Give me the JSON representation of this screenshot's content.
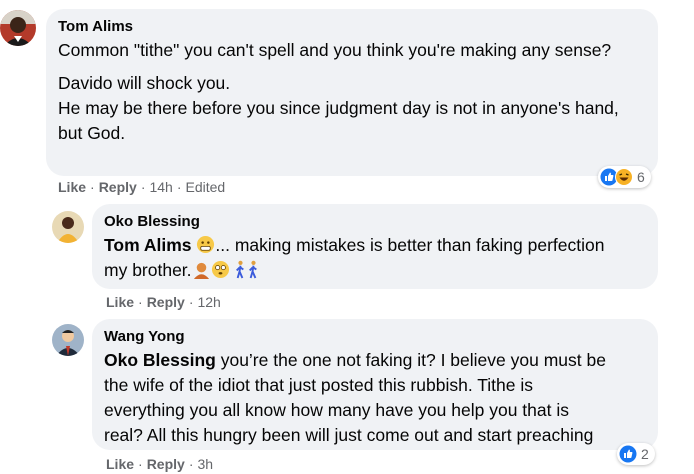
{
  "comments": [
    {
      "author": "Tom Alims",
      "paragraphs": [
        "Common \"tithe\" you can't spell and you think you're making any sense?",
        "Davido will shock you.",
        "He may be there before you since judgment day is not in anyone's hand, but God."
      ],
      "actions": {
        "like": "Like",
        "reply": "Reply",
        "time": "14h",
        "edited": "Edited"
      },
      "reactions": {
        "count": "6",
        "icons": [
          "like-icon",
          "haha-icon"
        ]
      }
    },
    {
      "author": "Oko Blessing",
      "mention": "Tom Alims",
      "text_part1": "... making mistakes is better than faking perfection",
      "text_part2": "my brother.",
      "actions": {
        "like": "Like",
        "reply": "Reply",
        "time": "12h"
      },
      "emojis": [
        "grimacing-face-emoji",
        "person-pouting-emoji",
        "flushed-face-emoji",
        "person-walking-emoji",
        "person-walking-emoji"
      ]
    },
    {
      "author": "Wang Yong",
      "mention": "Oko Blessing",
      "text_lines": [
        " you’re the one not faking it? I believe you must be",
        "the wife of the idiot that just posted this rubbish. Tithe is",
        "everything you all know how many have you help you that is",
        "real? All this hungry been will just come out and start preaching"
      ],
      "actions": {
        "like": "Like",
        "reply": "Reply",
        "time": "3h"
      },
      "reactions": {
        "count": "2",
        "icons": [
          "like-icon"
        ]
      }
    }
  ],
  "colors": {
    "bubble": "#f0f2f5",
    "meta": "#65676b",
    "like_blue": "#1877f2",
    "haha_yellow": "#f7b125"
  }
}
